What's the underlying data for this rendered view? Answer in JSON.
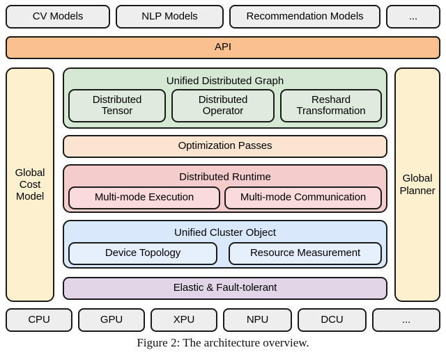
{
  "figure": {
    "caption": "Figure 2: The architecture overview."
  },
  "colors": {
    "api_bar": "#fac08f",
    "side_column": "#fdf0cf",
    "graph_panel": "#d5e8d4",
    "optimization_passes": "#fbe4d0",
    "runtime_panel": "#f5cccc",
    "cluster_panel": "#dae8fc",
    "elastic_bar": "#e1d5e7",
    "hardware_box": "#eeeeee",
    "model_box": "#eeeeee",
    "outline": "#1a1a1a"
  },
  "models_row": {
    "items": [
      {
        "label": "CV Models"
      },
      {
        "label": "NLP Models"
      },
      {
        "label": "Recommendation Models"
      },
      {
        "label": "..."
      }
    ]
  },
  "api": {
    "label": "API"
  },
  "side_columns": {
    "left": {
      "label": "Global\nCost\nModel"
    },
    "right": {
      "label": "Global\nPlanner"
    }
  },
  "unified_distributed_graph": {
    "title": "Unified Distributed Graph",
    "children": [
      {
        "label": "Distributed\nTensor"
      },
      {
        "label": "Distributed\nOperator"
      },
      {
        "label": "Reshard\nTransformation"
      }
    ]
  },
  "optimization_passes": {
    "label": "Optimization Passes"
  },
  "distributed_runtime": {
    "title": "Distributed Runtime",
    "children": [
      {
        "label": "Multi-mode Execution"
      },
      {
        "label": "Multi-mode Communication"
      }
    ]
  },
  "unified_cluster_object": {
    "title": "Unified Cluster Object",
    "children": [
      {
        "label": "Device Topology"
      },
      {
        "label": "Resource Measurement"
      }
    ]
  },
  "elastic": {
    "label": "Elastic & Fault-tolerant"
  },
  "hardware_row": {
    "items": [
      {
        "label": "CPU"
      },
      {
        "label": "GPU"
      },
      {
        "label": "XPU"
      },
      {
        "label": "NPU"
      },
      {
        "label": "DCU"
      },
      {
        "label": "..."
      }
    ]
  }
}
